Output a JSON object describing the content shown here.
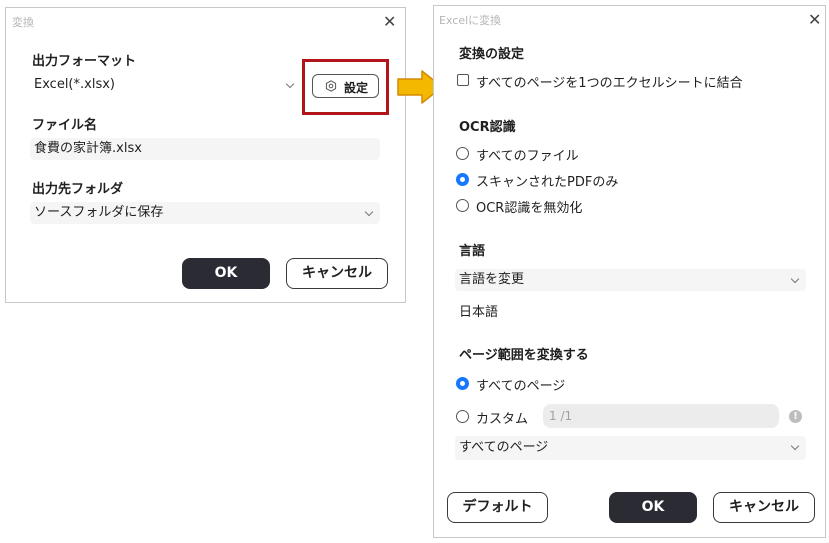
{
  "left_dialog": {
    "title": "変換",
    "output_format_label": "出力フォーマット",
    "output_format_value": "Excel(*.xlsx)",
    "settings_button": "設定",
    "file_name_label": "ファイル名",
    "file_name_value": "食費の家計簿.xlsx",
    "output_folder_label": "出力先フォルダ",
    "output_folder_value": "ソースフォルダに保存",
    "ok_button": "OK",
    "cancel_button": "キャンセル"
  },
  "right_dialog": {
    "title": "Excelに変換",
    "conversion_settings_label": "変換の設定",
    "merge_checkbox_label": "すべてのページを1つのエクセルシートに結合",
    "merge_checked": false,
    "ocr_label": "OCR認識",
    "ocr_options": [
      "すべてのファイル",
      "スキャンされたPDFのみ",
      "OCR認識を無効化"
    ],
    "ocr_selected": "スキャンされたPDFのみ",
    "language_label": "言語",
    "language_select": "言語を変更",
    "language_value": "日本語",
    "page_range_label": "ページ範囲を変換する",
    "page_range_options": [
      "すべてのページ",
      "カスタム"
    ],
    "page_range_selected": "すべてのページ",
    "custom_range_placeholder": "1 /1",
    "page_subset_select": "すべてのページ",
    "default_button": "デフォルト",
    "ok_button": "OK",
    "cancel_button": "キャンセル"
  },
  "colors": {
    "highlight_border": "#b3131b",
    "arrow_fill": "#f5b800",
    "arrow_stroke": "#d48a00",
    "radio_selected": "#1677ff",
    "dark_button": "#2b2b34"
  }
}
